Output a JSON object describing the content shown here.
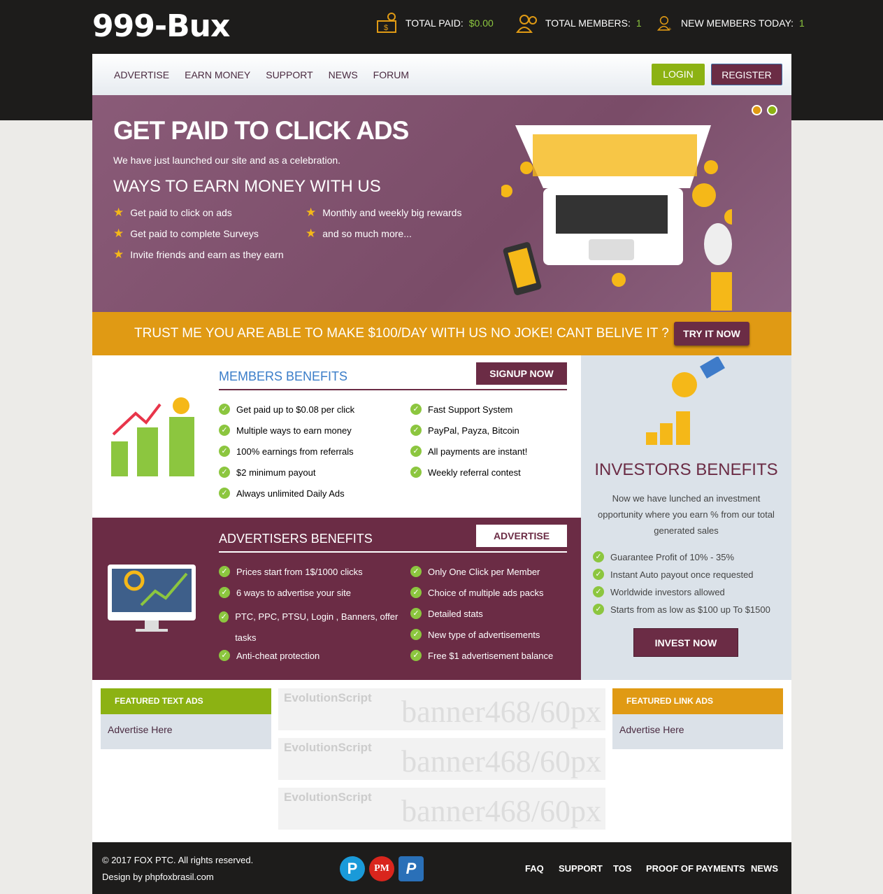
{
  "header": {
    "logo": "999-Bux",
    "stats": [
      {
        "label": "TOTAL PAID:",
        "value": "$0.00",
        "icon": "money-icon"
      },
      {
        "label": "TOTAL MEMBERS:",
        "value": "1",
        "icon": "users-icon"
      },
      {
        "label": "NEW MEMBERS TODAY:",
        "value": "1",
        "icon": "user-add-icon"
      }
    ]
  },
  "nav": {
    "items": [
      "ADVERTISE",
      "EARN MONEY",
      "SUPPORT",
      "NEWS",
      "FORUM"
    ],
    "login": "LOGIN",
    "register": "REGISTER"
  },
  "hero": {
    "title": "GET PAID TO CLICK ADS",
    "subtitle": "We have just launched our site and as a celebration.",
    "heading": "WAYS TO EARN MONEY WITH US",
    "items": [
      "Get paid to click on ads",
      "Monthly and weekly big rewards",
      "Get paid to complete Surveys",
      "and so much more...",
      "Invite friends and earn as they earn"
    ]
  },
  "trust": {
    "text": "TRUST ME YOU ARE ABLE TO MAKE $100/DAY WITH US NO JOKE! CANT BELIVE IT ?",
    "button": "TRY IT NOW"
  },
  "members": {
    "title": "MEMBERS BENEFITS",
    "button": "SIGNUP NOW",
    "left": [
      "Get paid up to $0.08 per click",
      "Multiple ways to earn money",
      "100% earnings from referrals",
      "$2 minimum payout",
      "Always unlimited Daily Ads"
    ],
    "right": [
      "Fast Support System",
      "PayPal, Payza, Bitcoin",
      "All payments are instant!",
      "Weekly referral contest"
    ]
  },
  "advertisers": {
    "title": "ADVERTISERS BENEFITS",
    "button": "ADVERTISE",
    "left": [
      "Prices start from 1$/1000 clicks",
      "6 ways to advertise your site",
      "PTC, PPC, PTSU, Login , Banners, offer tasks",
      "Anti-cheat protection"
    ],
    "right": [
      "Only One Click per Member",
      "Choice of multiple ads packs",
      "Detailed stats",
      "New type of advertisements",
      "Free $1 advertisement balance"
    ]
  },
  "investors": {
    "title": "INVESTORS BENEFITS",
    "text": "Now we have lunched an investment opportunity where you earn % from our total generated sales",
    "items": [
      "Guarantee Profit of 10% - 35%",
      "Instant Auto payout once requested",
      "Worldwide investors allowed",
      "Starts from as low as $100 up To $1500"
    ],
    "button": "INVEST NOW"
  },
  "featured": {
    "text_ads": "FEATURED TEXT ADS",
    "link_ads": "FEATURED LINK ADS",
    "advertise": "Advertise Here",
    "banner_brand": "EvolutionScript",
    "banner_text": "banner468/60px"
  },
  "footer": {
    "copyright": "© 2017 FOX PTC. All rights reserved.",
    "design": "Design by phpfoxbrasil.com",
    "payments": [
      "P",
      "PM",
      "P"
    ],
    "links": [
      "FAQ",
      "SUPPORT",
      "TOS",
      "PROOF OF PAYMENTS",
      "NEWS"
    ]
  },
  "colors": {
    "purple": "#6b2c45",
    "orange": "#e09a14",
    "green": "#8cb213"
  }
}
